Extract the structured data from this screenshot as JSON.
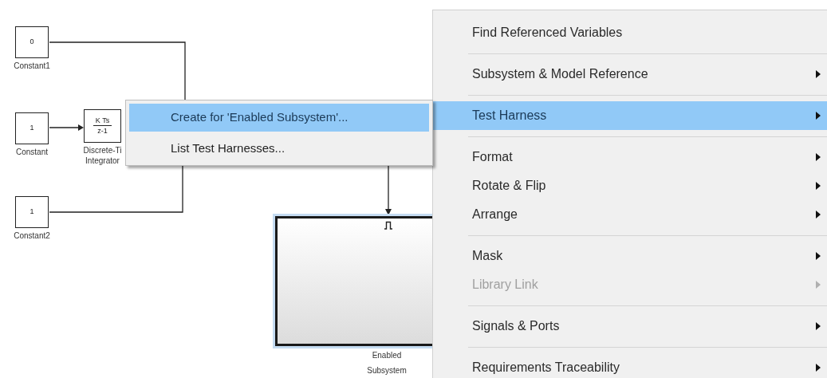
{
  "diagram": {
    "blocks": [
      {
        "kind": "constant",
        "value": "0",
        "label_lines": [
          "Constant1"
        ]
      },
      {
        "kind": "constant",
        "value": "1",
        "label_lines": [
          "Constant"
        ]
      },
      {
        "kind": "integrator",
        "numerator": "K Ts",
        "denominator": "z-1",
        "label_lines": [
          "Discrete-Ti",
          "Integrator"
        ]
      },
      {
        "kind": "constant",
        "value": "1",
        "label_lines": [
          "Constant2"
        ]
      }
    ],
    "subsystem": {
      "label_lines": [
        "Enabled",
        "Subsystem"
      ],
      "selected": true
    }
  },
  "submenu": {
    "items": [
      {
        "label": "Create for 'Enabled Subsystem'...",
        "selected": true
      },
      {
        "label": "List Test Harnesses...",
        "selected": false
      }
    ]
  },
  "context_menu": {
    "items": [
      {
        "label": "Find Referenced Variables",
        "submenu": false,
        "disabled": false,
        "selected": false,
        "separator_after": true
      },
      {
        "label": "Subsystem & Model Reference",
        "submenu": true,
        "disabled": false,
        "selected": false,
        "separator_after": true
      },
      {
        "label": "Test Harness",
        "submenu": true,
        "disabled": false,
        "selected": true,
        "separator_after": true
      },
      {
        "label": "Format",
        "submenu": true,
        "disabled": false,
        "selected": false,
        "separator_after": false
      },
      {
        "label": "Rotate & Flip",
        "submenu": true,
        "disabled": false,
        "selected": false,
        "separator_after": false
      },
      {
        "label": "Arrange",
        "submenu": true,
        "disabled": false,
        "selected": false,
        "separator_after": true
      },
      {
        "label": "Mask",
        "submenu": true,
        "disabled": false,
        "selected": false,
        "separator_after": false
      },
      {
        "label": "Library Link",
        "submenu": true,
        "disabled": true,
        "selected": false,
        "separator_after": true
      },
      {
        "label": "Signals & Ports",
        "submenu": true,
        "disabled": false,
        "selected": false,
        "separator_after": true
      },
      {
        "label": "Requirements Traceability",
        "submenu": true,
        "disabled": false,
        "selected": false,
        "separator_after": false
      }
    ]
  }
}
